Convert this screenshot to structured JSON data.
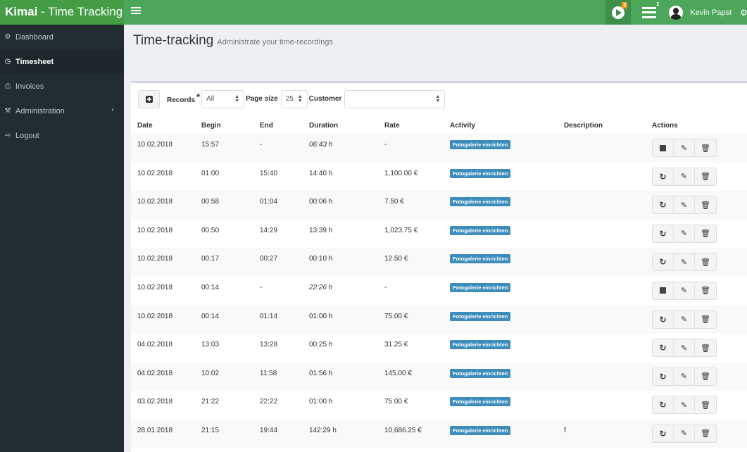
{
  "app": {
    "title_bold": "Kimai",
    "title_rest": " - Time Tracking"
  },
  "navbar": {
    "active_timers_badge": "2",
    "recent_badge": "2",
    "user_name": "Kevin Papst"
  },
  "sidebar": {
    "items": [
      {
        "label": "Dashboard",
        "icon": "dashboard-icon",
        "glyph": "⚙",
        "active": false
      },
      {
        "label": "Timesheet",
        "icon": "clock-icon",
        "glyph": "◷",
        "active": true
      },
      {
        "label": "Invoices",
        "icon": "print-icon",
        "glyph": "⎙",
        "active": false
      },
      {
        "label": "Administration",
        "icon": "wrench-icon",
        "glyph": "⚒",
        "active": false,
        "has_submenu": true
      },
      {
        "label": "Logout",
        "icon": "logout-icon",
        "glyph": "⇨",
        "active": false
      }
    ]
  },
  "page": {
    "title": "Time-tracking",
    "subtitle": "Administrate your time-recordings"
  },
  "toolbar": {
    "records_label": "Records",
    "records_value": "All",
    "pagesize_label": "Page size",
    "pagesize_value": "25",
    "customer_label": "Customer",
    "customer_value": ""
  },
  "table": {
    "columns": [
      "Date",
      "Begin",
      "End",
      "Duration",
      "Rate",
      "Activity",
      "Description",
      "Actions"
    ],
    "rows": [
      {
        "date": "10.02.2018",
        "begin": "15:57",
        "end": "-",
        "duration": "06:43 h",
        "rate": "-",
        "activity": "Fotogalerie einrichten",
        "description": "",
        "running": true
      },
      {
        "date": "10.02.2018",
        "begin": "01:00",
        "end": "15:40",
        "duration": "14:40 h",
        "rate": "1,100.00 €",
        "activity": "Fotogalerie einrichten",
        "description": "",
        "running": false
      },
      {
        "date": "10.02.2018",
        "begin": "00:58",
        "end": "01:04",
        "duration": "00:06 h",
        "rate": "7.50 €",
        "activity": "Fotogalerie einrichten",
        "description": "",
        "running": false
      },
      {
        "date": "10.02.2018",
        "begin": "00:50",
        "end": "14:29",
        "duration": "13:39 h",
        "rate": "1,023.75 €",
        "activity": "Fotogalerie einrichten",
        "description": "",
        "running": false
      },
      {
        "date": "10.02.2018",
        "begin": "00:17",
        "end": "00:27",
        "duration": "00:10 h",
        "rate": "12.50 €",
        "activity": "Fotogalerie einrichten",
        "description": "",
        "running": false
      },
      {
        "date": "10.02.2018",
        "begin": "00:14",
        "end": "-",
        "duration": "22:26 h",
        "rate": "-",
        "activity": "Fotogalerie einrichten",
        "description": "",
        "running": true
      },
      {
        "date": "10.02.2018",
        "begin": "00:14",
        "end": "01:14",
        "duration": "01:00 h",
        "rate": "75.00 €",
        "activity": "Fotogalerie einrichten",
        "description": "",
        "running": false
      },
      {
        "date": "04.02.2018",
        "begin": "13:03",
        "end": "13:28",
        "duration": "00:25 h",
        "rate": "31.25 €",
        "activity": "Fotogalerie einrichten",
        "description": "",
        "running": false
      },
      {
        "date": "04.02.2018",
        "begin": "10:02",
        "end": "11:58",
        "duration": "01:56 h",
        "rate": "145.00 €",
        "activity": "Fotogalerie einrichten",
        "description": "",
        "running": false
      },
      {
        "date": "03.02.2018",
        "begin": "21:22",
        "end": "22:22",
        "duration": "01:00 h",
        "rate": "75.00 €",
        "activity": "Fotogalerie einrichten",
        "description": "",
        "running": false
      },
      {
        "date": "28.01.2018",
        "begin": "21:15",
        "end": "19:44",
        "duration": "142:29 h",
        "rate": "10,686.25 €",
        "activity": "Fotogalerie einrichten",
        "description": "f",
        "running": false
      }
    ]
  },
  "colors": {
    "brand_green": "#449d44",
    "navbar_green": "#4ca75a",
    "sidebar_bg": "#222d32",
    "activity_label": "#3c8dbc",
    "badge_orange": "#f39c12"
  }
}
